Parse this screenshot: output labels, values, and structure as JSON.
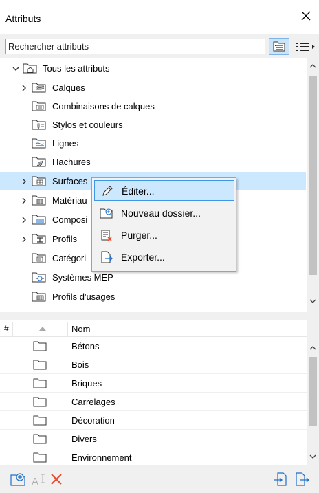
{
  "window": {
    "title": "Attributs"
  },
  "search": {
    "placeholder": "Rechercher attributs"
  },
  "colors": {
    "selected_row": "#cce8ff",
    "accent_border": "#3d97e6",
    "delete_red": "#e8462b",
    "icon_blue": "#1e6fc7"
  },
  "tree": {
    "items": [
      {
        "label": "Tous les attributs",
        "icon": "home-folder-icon",
        "expand": "open"
      },
      {
        "label": "Calques",
        "icon": "layers-folder-icon",
        "expand": "closed"
      },
      {
        "label": "Combinaisons de calques",
        "icon": "layer-combinations-folder-icon",
        "expand": "none"
      },
      {
        "label": "Stylos et couleurs",
        "icon": "pens-folder-icon",
        "expand": "none"
      },
      {
        "label": "Lignes",
        "icon": "lines-folder-icon",
        "expand": "none"
      },
      {
        "label": "Hachures",
        "icon": "fills-folder-icon",
        "expand": "none"
      },
      {
        "label": "Surfaces",
        "icon": "surfaces-folder-icon",
        "expand": "closed",
        "selected": true
      },
      {
        "label": "Matériau",
        "icon": "materials-folder-icon",
        "expand": "closed"
      },
      {
        "label": "Composi",
        "icon": "composites-folder-icon",
        "expand": "closed"
      },
      {
        "label": "Profils",
        "icon": "profiles-folder-icon",
        "expand": "closed"
      },
      {
        "label": "Catégori",
        "icon": "categories-folder-icon",
        "expand": "none"
      },
      {
        "label": "Systèmes MEP",
        "icon": "mep-systems-folder-icon",
        "expand": "none"
      },
      {
        "label": "Profils d'usages",
        "icon": "usage-profiles-folder-icon",
        "expand": "none"
      }
    ]
  },
  "context_menu": {
    "items": [
      {
        "label": "Éditer...",
        "icon": "pencil-icon",
        "hover": true
      },
      {
        "label": "Nouveau dossier...",
        "icon": "new-folder-icon"
      },
      {
        "label": "Purger...",
        "icon": "purge-icon"
      },
      {
        "label": "Exporter...",
        "icon": "export-icon"
      }
    ]
  },
  "list": {
    "columns": {
      "hash": "#",
      "name": "Nom"
    },
    "rows": [
      {
        "name": "Bétons"
      },
      {
        "name": "Bois"
      },
      {
        "name": "Briques"
      },
      {
        "name": "Carrelages"
      },
      {
        "name": "Décoration"
      },
      {
        "name": "Divers"
      },
      {
        "name": "Environnement"
      }
    ]
  },
  "toolbar": {
    "new_folder": "new-folder-icon",
    "rename": "rename-icon",
    "delete": "delete-icon",
    "import": "import-icon",
    "export": "export-icon"
  }
}
